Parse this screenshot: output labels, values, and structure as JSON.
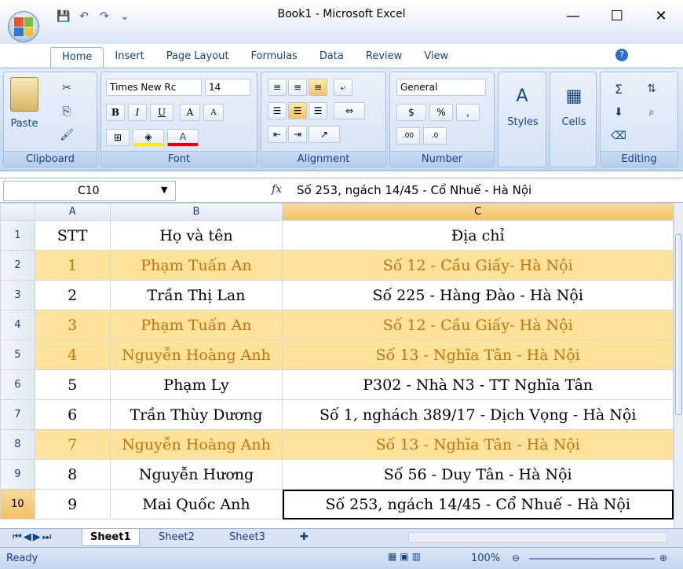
{
  "window": {
    "title": "Book1 - Microsoft Excel",
    "minimize": "—",
    "maximize": "☐",
    "close": "✕"
  },
  "qat": {
    "save": "💾",
    "undo": "↶",
    "redo": "↷",
    "customize": "⌄"
  },
  "tabs": [
    "Home",
    "Insert",
    "Page Layout",
    "Formulas",
    "Data",
    "Review",
    "View"
  ],
  "active_tab": "Home",
  "ribbon": {
    "clipboard": {
      "label": "Clipboard",
      "paste": "Paste"
    },
    "font": {
      "label": "Font",
      "name": "Times New Rc",
      "size": "14",
      "bold": "B",
      "italic": "I",
      "underline": "U",
      "grow": "A",
      "shrink": "A"
    },
    "alignment": {
      "label": "Alignment"
    },
    "number": {
      "label": "Number",
      "format": "General",
      "currency": "$",
      "percent": "%",
      "comma": ","
    },
    "styles": {
      "label": "Styles"
    },
    "cells": {
      "label": "Cells"
    },
    "editing": {
      "label": "Editing"
    }
  },
  "formula_bar": {
    "name_box": "C10",
    "fx": "fx",
    "content": "Số 253, ngách 14/45 - Cổ Nhuế - Hà Nội"
  },
  "grid": {
    "columns": [
      "A",
      "B",
      "C"
    ],
    "rows": [
      {
        "n": "1",
        "a": "STT",
        "b": "Họ và tên",
        "c": "Địa chỉ",
        "hl": false
      },
      {
        "n": "2",
        "a": "1",
        "b": "Phạm Tuấn An",
        "c": "Số 12 - Cầu Giấy- Hà Nội",
        "hl": true
      },
      {
        "n": "3",
        "a": "2",
        "b": "Trần Thị Lan",
        "c": "Số 225 - Hàng Đào - Hà Nội",
        "hl": false
      },
      {
        "n": "4",
        "a": "3",
        "b": "Phạm Tuấn An",
        "c": "Số 12 - Cầu Giấy- Hà Nội",
        "hl": true
      },
      {
        "n": "5",
        "a": "4",
        "b": "Nguyễn Hoàng Anh",
        "c": "Số 13 - Nghĩa Tân - Hà Nội",
        "hl": true
      },
      {
        "n": "6",
        "a": "5",
        "b": "Phạm Ly",
        "c": "P302 - Nhà N3 - TT Nghĩa Tân",
        "hl": false
      },
      {
        "n": "7",
        "a": "6",
        "b": "Trần Thùy Dương",
        "c": "Số 1, nghách 389/17 - Dịch Vọng - Hà Nội",
        "hl": false
      },
      {
        "n": "8",
        "a": "7",
        "b": "Nguyễn Hoàng Anh",
        "c": "Số 13 - Nghĩa Tân - Hà Nội",
        "hl": true
      },
      {
        "n": "9",
        "a": "8",
        "b": "Nguyễn Hương",
        "c": "Số 56 - Duy Tân - Hà Nội",
        "hl": false
      },
      {
        "n": "10",
        "a": "9",
        "b": "Mai Quốc Anh",
        "c": "Số 253, ngách 14/45 - Cổ Nhuế - Hà Nội",
        "hl": false
      }
    ]
  },
  "sheets": [
    "Sheet1",
    "Sheet2",
    "Sheet3"
  ],
  "active_sheet": "Sheet1",
  "status": {
    "text": "Ready",
    "zoom": "100%"
  },
  "colors": {
    "highlight_fill": "#ffe39a",
    "highlight_text": "#c9700a",
    "header_selected": "#f1c15f"
  }
}
